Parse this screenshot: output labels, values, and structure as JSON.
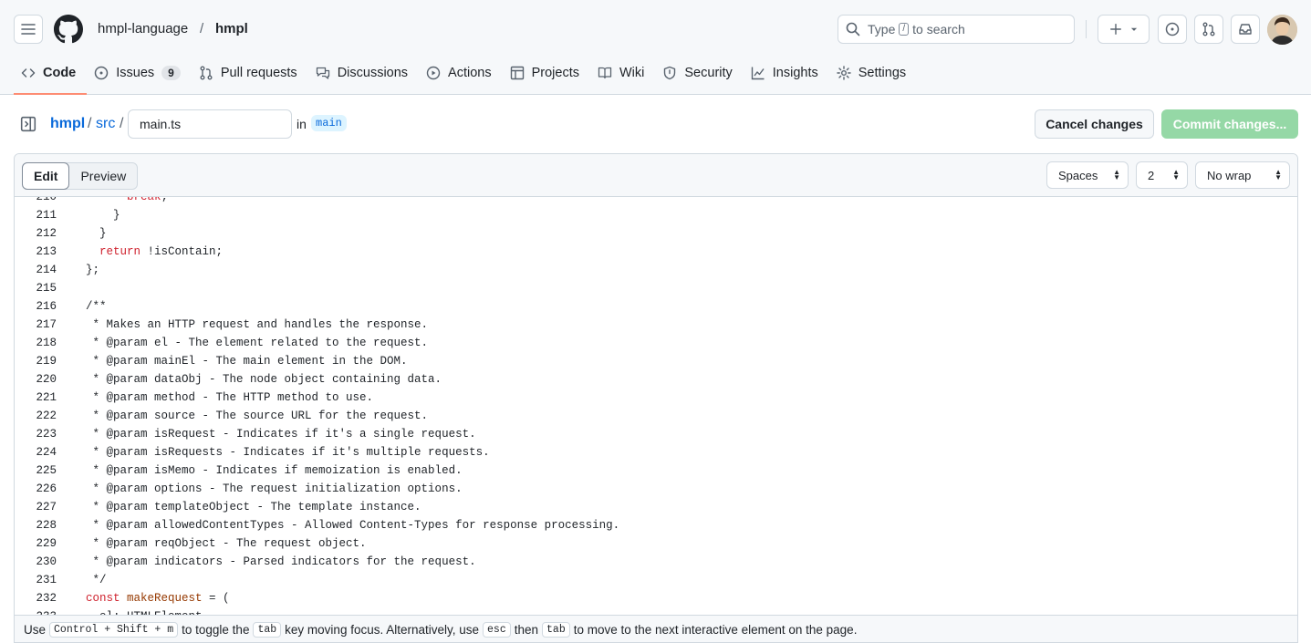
{
  "header": {
    "owner": "hmpl-language",
    "separator": "/",
    "repo": "hmpl",
    "search_prefix": "Type",
    "search_key": "/",
    "search_suffix": "to search"
  },
  "nav": {
    "items": [
      {
        "label": "Code",
        "icon": "code-icon"
      },
      {
        "label": "Issues",
        "icon": "issue-opened-icon",
        "count": "9"
      },
      {
        "label": "Pull requests",
        "icon": "git-pull-request-icon"
      },
      {
        "label": "Discussions",
        "icon": "comment-discussion-icon"
      },
      {
        "label": "Actions",
        "icon": "play-icon"
      },
      {
        "label": "Projects",
        "icon": "table-icon"
      },
      {
        "label": "Wiki",
        "icon": "book-icon"
      },
      {
        "label": "Security",
        "icon": "shield-icon"
      },
      {
        "label": "Insights",
        "icon": "graph-icon"
      },
      {
        "label": "Settings",
        "icon": "gear-icon"
      }
    ]
  },
  "filebar": {
    "path_owner": "hmpl",
    "sep": "/",
    "path_dir": "src",
    "filename": "main.ts",
    "in_label": "in",
    "branch": "main",
    "cancel_label": "Cancel changes",
    "commit_label": "Commit changes..."
  },
  "editor": {
    "tab_edit": "Edit",
    "tab_preview": "Preview",
    "indent_mode": "Spaces",
    "indent_size": "2",
    "wrap_mode": "No wrap"
  },
  "code_lines": [
    {
      "n": "210",
      "parts": [
        [
          "      ",
          ""
        ],
        [
          "break",
          "kw"
        ],
        [
          ";",
          ""
        ]
      ]
    },
    {
      "n": "211",
      "parts": [
        [
          "    }",
          ""
        ]
      ]
    },
    {
      "n": "212",
      "parts": [
        [
          "  }",
          ""
        ]
      ]
    },
    {
      "n": "213",
      "parts": [
        [
          "  ",
          ""
        ],
        [
          "return",
          "kw"
        ],
        [
          " !isContain;",
          ""
        ]
      ]
    },
    {
      "n": "214",
      "parts": [
        [
          "};",
          ""
        ]
      ]
    },
    {
      "n": "215",
      "parts": [
        [
          "",
          ""
        ]
      ]
    },
    {
      "n": "216",
      "parts": [
        [
          "/**",
          ""
        ]
      ]
    },
    {
      "n": "217",
      "parts": [
        [
          " * Makes an HTTP request and handles the response.",
          ""
        ]
      ]
    },
    {
      "n": "218",
      "parts": [
        [
          " * @param el - The element related to the request.",
          ""
        ]
      ]
    },
    {
      "n": "219",
      "parts": [
        [
          " * @param mainEl - The main element in the DOM.",
          ""
        ]
      ]
    },
    {
      "n": "220",
      "parts": [
        [
          " * @param dataObj - The node object containing data.",
          ""
        ]
      ]
    },
    {
      "n": "221",
      "parts": [
        [
          " * @param method - The HTTP method to use.",
          ""
        ]
      ]
    },
    {
      "n": "222",
      "parts": [
        [
          " * @param source - The source URL for the request.",
          ""
        ]
      ]
    },
    {
      "n": "223",
      "parts": [
        [
          " * @param isRequest - Indicates if it's a single request.",
          ""
        ]
      ]
    },
    {
      "n": "224",
      "parts": [
        [
          " * @param isRequests - Indicates if it's multiple requests.",
          ""
        ]
      ]
    },
    {
      "n": "225",
      "parts": [
        [
          " * @param isMemo - Indicates if memoization is enabled.",
          ""
        ]
      ]
    },
    {
      "n": "226",
      "parts": [
        [
          " * @param options - The request initialization options.",
          ""
        ]
      ]
    },
    {
      "n": "227",
      "parts": [
        [
          " * @param templateObject - The template instance.",
          ""
        ]
      ]
    },
    {
      "n": "228",
      "parts": [
        [
          " * @param allowedContentTypes - Allowed Content-Types for response processing.",
          ""
        ]
      ]
    },
    {
      "n": "229",
      "parts": [
        [
          " * @param reqObject - The request object.",
          ""
        ]
      ]
    },
    {
      "n": "230",
      "parts": [
        [
          " * @param indicators - Parsed indicators for the request.",
          ""
        ]
      ]
    },
    {
      "n": "231",
      "parts": [
        [
          " */",
          ""
        ]
      ]
    },
    {
      "n": "232",
      "parts": [
        [
          "const",
          "kw"
        ],
        [
          " ",
          ""
        ],
        [
          "makeRequest",
          "fn"
        ],
        [
          " = (",
          ""
        ]
      ]
    },
    {
      "n": "233",
      "parts": [
        [
          "  el: HTMLElement",
          ""
        ]
      ]
    }
  ],
  "hint": {
    "use": "Use",
    "combo": "Control + Shift + m",
    "to_toggle": "to toggle the",
    "tab_key": "tab",
    "rest1": "key moving focus. Alternatively, use",
    "esc_key": "esc",
    "then": "then",
    "tab_key2": "tab",
    "rest2": "to move to the next interactive element on the page."
  }
}
